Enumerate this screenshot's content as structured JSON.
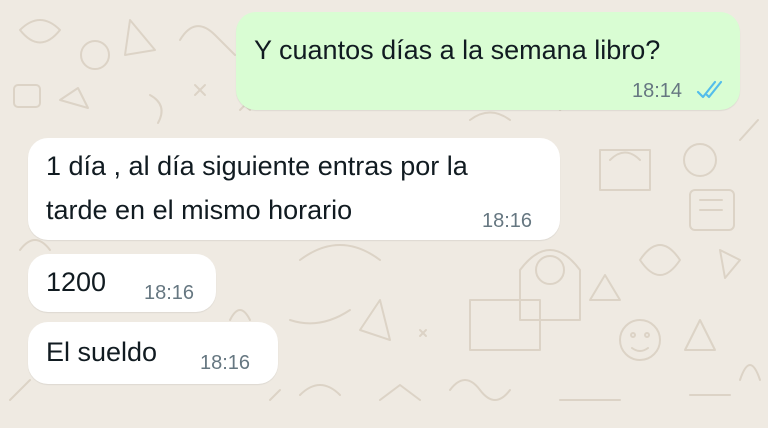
{
  "colors": {
    "background": "#efeae2",
    "outgoing_bubble": "#d9fdd3",
    "incoming_bubble": "#ffffff",
    "read_ticks": "#53bdeb",
    "time_text": "#667781"
  },
  "messages": [
    {
      "direction": "outgoing",
      "lines": [
        "Y cuantos días a la semana libro?"
      ],
      "time": "18:14",
      "status_icon": "double-check-read-icon"
    },
    {
      "direction": "incoming",
      "lines": [
        "1 día , al día siguiente entras por la",
        "tarde en el mismo horario"
      ],
      "time": "18:16"
    },
    {
      "direction": "incoming",
      "lines": [
        "1200"
      ],
      "time": "18:16"
    },
    {
      "direction": "incoming",
      "lines": [
        "El sueldo"
      ],
      "time": "18:16"
    }
  ]
}
